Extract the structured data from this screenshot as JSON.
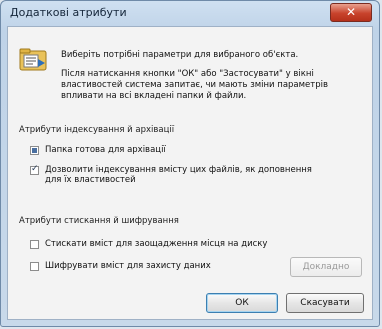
{
  "window": {
    "title": "Додаткові атрибути",
    "close_label": "✕"
  },
  "intro": {
    "line1": "Виберіть потрібні параметри для вибраного об'єкта.",
    "line2": "Після натискання кнопки \"ОК\" або \"Застосувати\" у вікні властивостей система запитає, чи мають зміни параметрів впливати на всі вкладені папки й файли."
  },
  "index_group": {
    "label": "Атрибути індексування й архівації",
    "archive_label": "Папка готова для архівації",
    "index_label": "Дозволити індексування вмісту цих файлів, як доповнення для їх властивостей"
  },
  "compress_group": {
    "label": "Атрибути стискання й шифрування",
    "compress_label": "Стискати вміст для заощадження місця на диску",
    "encrypt_label": "Шифрувати вміст для захисту даних",
    "details_label": "Докладно"
  },
  "buttons": {
    "ok": "ОК",
    "cancel": "Скасувати"
  },
  "colors": {
    "title_bar": "#cfe0f1",
    "close": "#c8432c",
    "client_bg": "#f3f3f3"
  }
}
